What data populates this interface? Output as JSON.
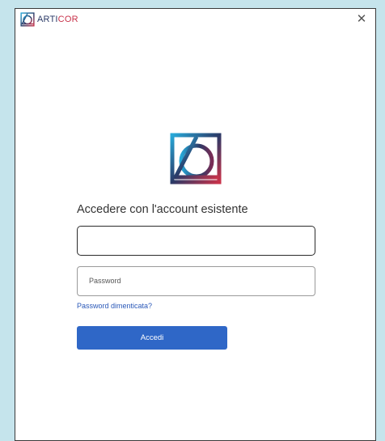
{
  "window": {
    "brand": {
      "prefix": "ARTI",
      "suffix": "COR"
    },
    "close_icon": "close-icon"
  },
  "login": {
    "logo_icon": "articor-logo-icon",
    "heading": "Accedere con l'account esistente",
    "username_value": "",
    "password_placeholder": "Password",
    "forgot_password_label": "Password dimenticata?",
    "submit_label": "Accedi"
  },
  "colors": {
    "background": "#c5e4ec",
    "primary_button": "#2f67c7",
    "link": "#2a58b8",
    "brand_navy": "#2b3a67",
    "brand_red": "#c8324a"
  }
}
